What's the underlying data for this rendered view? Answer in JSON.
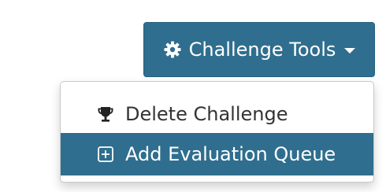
{
  "toolbar": {
    "tools_label": "Challenge Tools",
    "tools_icon": "gear-icon",
    "caret_icon": "caret-down-icon"
  },
  "menu": {
    "items": [
      {
        "label": "Delete Challenge",
        "icon": "trophy-icon",
        "highlighted": false
      },
      {
        "label": "Add Evaluation Queue",
        "icon": "plus-square-icon",
        "highlighted": true
      }
    ]
  },
  "colors": {
    "accent": "#2f6e8e",
    "text": "#333333",
    "menu_border": "#c8c8c8"
  }
}
